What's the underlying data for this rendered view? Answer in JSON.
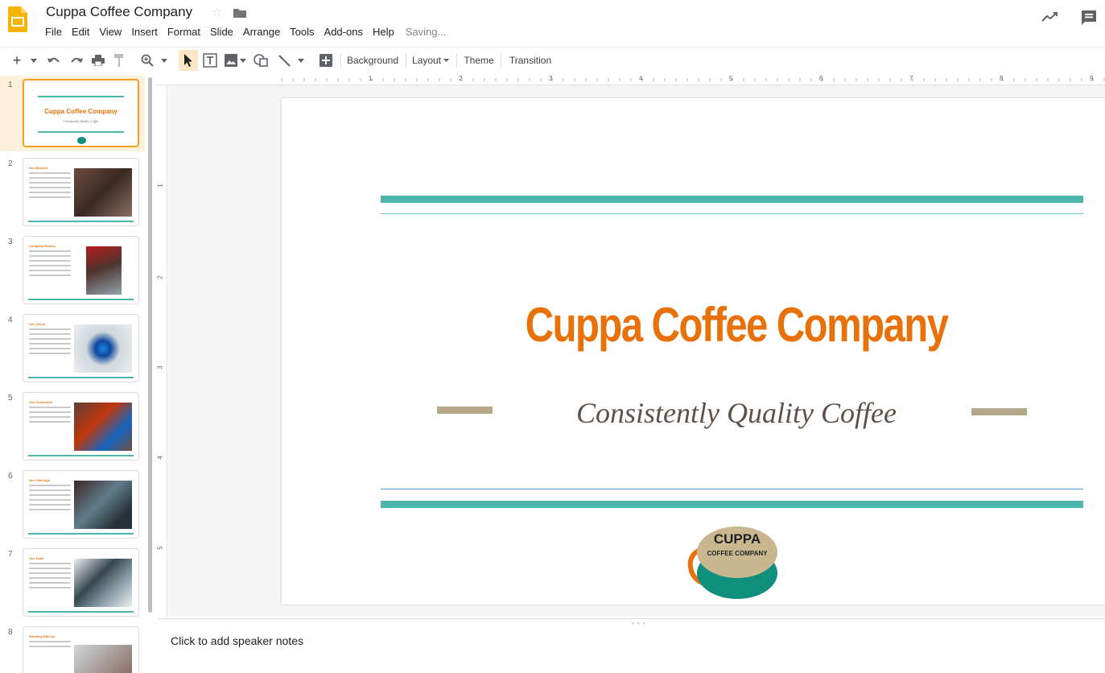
{
  "header": {
    "title": "Cuppa Coffee Company",
    "menus": [
      "File",
      "Edit",
      "View",
      "Insert",
      "Format",
      "Slide",
      "Arrange",
      "Tools",
      "Add-ons",
      "Help"
    ],
    "status": "Saving..."
  },
  "toolbar": {
    "background_label": "Background",
    "layout_label": "Layout",
    "theme_label": "Theme",
    "transition_label": "Transition"
  },
  "filmstrip": {
    "slides": [
      {
        "num": "1",
        "heading": "Cuppa Coffee Company",
        "sub": "Consistently Quality Coffee"
      },
      {
        "num": "2",
        "heading": "Our Mission"
      },
      {
        "num": "3",
        "heading": "Company History"
      },
      {
        "num": "4",
        "heading": "Our Vision"
      },
      {
        "num": "5",
        "heading": "Our Customers"
      },
      {
        "num": "6",
        "heading": "Our Offerings"
      },
      {
        "num": "7",
        "heading": "Our Team"
      },
      {
        "num": "8",
        "heading": "Working With Us"
      }
    ]
  },
  "ruler": {
    "h": [
      "1",
      "2",
      "3",
      "4",
      "5",
      "6",
      "7",
      "8",
      "9"
    ],
    "v": [
      "1",
      "2",
      "3",
      "4",
      "5"
    ]
  },
  "slide": {
    "title": "Cuppa Coffee Company",
    "subtitle": "Consistently Quality Coffee",
    "logo_line1": "CUPPA",
    "logo_line2": "COFFEE COMPANY"
  },
  "notes": {
    "placeholder": "Click to add speaker notes"
  },
  "colors": {
    "accent_orange": "#e8710a",
    "teal": "#4db6ac",
    "tan": "#b5a88a",
    "selection": "#f3a21f"
  }
}
